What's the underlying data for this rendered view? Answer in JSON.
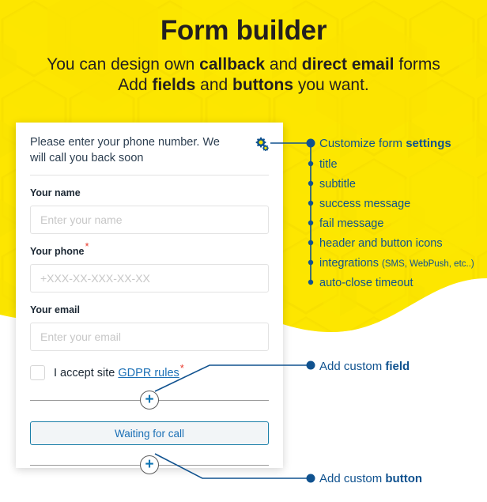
{
  "hero": {
    "title": "Form builder",
    "subtitle_line1_a": "You can design own ",
    "subtitle_line1_b": "callback",
    "subtitle_line1_c": " and ",
    "subtitle_line1_d": "direct email",
    "subtitle_line1_e": " forms",
    "subtitle_line2_a": "Add ",
    "subtitle_line2_b": "fields",
    "subtitle_line2_c": " and ",
    "subtitle_line2_d": "buttons",
    "subtitle_line2_e": " you want."
  },
  "form": {
    "header_text": "Please enter your phone number. We will call you back soon",
    "settings_icon": "cogs-icon",
    "fields": [
      {
        "label": "Your name",
        "required": false,
        "placeholder": "Enter your name"
      },
      {
        "label": "Your phone",
        "required": true,
        "placeholder": "+XXX-XX-XXX-XX-XX"
      },
      {
        "label": "Your email",
        "required": false,
        "placeholder": "Enter your email"
      }
    ],
    "required_marker": "*",
    "gdpr": {
      "text_before": "I accept site ",
      "link": "GDPR rules",
      "required_marker": "*"
    },
    "add_field_plus": "+",
    "add_button_plus": "+",
    "submit_label": "Waiting for call"
  },
  "annotations": {
    "settings_group": [
      {
        "text_a": "Customize form ",
        "text_b": "settings",
        "lead": true
      },
      {
        "text_a": "title",
        "text_b": ""
      },
      {
        "text_a": "subtitle",
        "text_b": ""
      },
      {
        "text_a": "success message",
        "text_b": ""
      },
      {
        "text_a": "fail message",
        "text_b": ""
      },
      {
        "text_a": "header and button icons",
        "text_b": ""
      },
      {
        "text_a": "integrations ",
        "text_small": "(SMS, WebPush, etc..)"
      },
      {
        "text_a": "auto-close timeout",
        "text_b": ""
      }
    ],
    "add_field": {
      "text_a": "Add custom ",
      "text_b": "field"
    },
    "add_button": {
      "text_a": "Add custom ",
      "text_b": "button"
    }
  },
  "colors": {
    "yellow": "#FDE600",
    "blue": "#10528f",
    "link_blue": "#1a6fb5",
    "accent_teal": "#1a7fa8",
    "required_red": "#e8392b",
    "dark_text": "#231f20"
  }
}
